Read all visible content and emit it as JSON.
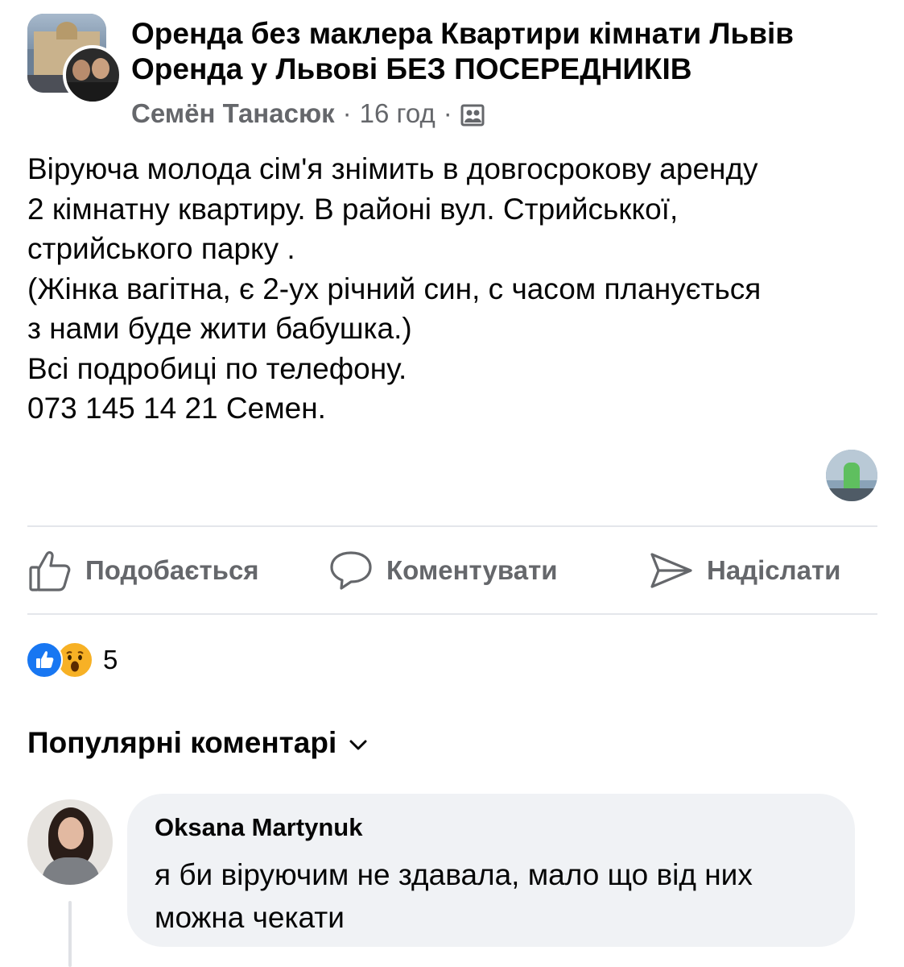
{
  "post": {
    "group_name": "Оренда без маклера Квартири кімнати Львів Оренда у Львові БЕЗ ПОСЕРЕДНИКІВ",
    "author": "Семён Танасюк",
    "time": "16 год",
    "separator": "·",
    "audience_icon": "members-icon",
    "body_lines": [
      "Віруюча молода сім'я знімить в довгосрокову аренду",
      "2 кімнатну квартиру. В районі вул. Стрийськкої,",
      "стрийського парку .",
      "(Жінка вагітна, є 2-ух річний син, с часом планується",
      "з нами буде жити бабушка.)",
      "Всі подробиці по телефону.",
      "073 145 14 21 Семен."
    ]
  },
  "actions": {
    "like": "Подобається",
    "comment": "Коментувати",
    "send": "Надіслати"
  },
  "reactions": {
    "types": [
      "like-icon",
      "wow-icon"
    ],
    "count": "5"
  },
  "comments_sort": "Популярні коментарі",
  "comments": [
    {
      "author": "Oksana Martynuk",
      "text_lines": [
        "я би віруючим не здавала, мало що від них",
        "можна чекати"
      ]
    }
  ],
  "colors": {
    "text_primary": "#050505",
    "text_secondary": "#65676b",
    "brand_blue": "#1877f2",
    "bubble_bg": "#f0f2f5",
    "divider": "#e4e6eb"
  }
}
